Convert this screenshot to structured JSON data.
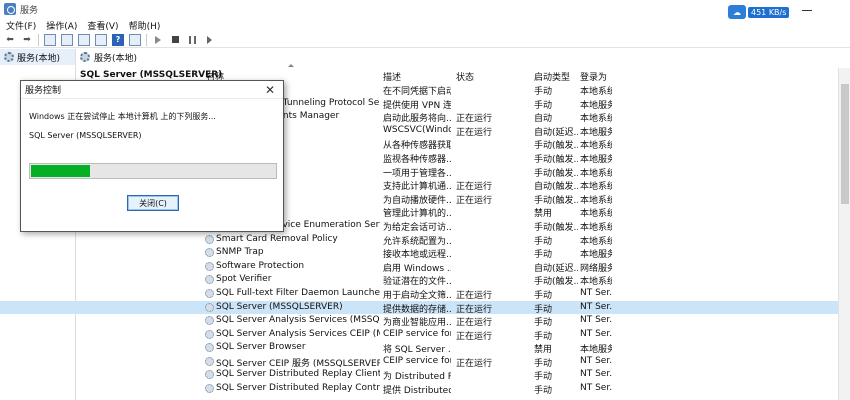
{
  "window": {
    "title": "服务",
    "net_speed": "451 KB/s"
  },
  "menu": [
    "文件(F)",
    "操作(A)",
    "查看(V)",
    "帮助(H)"
  ],
  "tree": {
    "root_label": "服务(本地)"
  },
  "main": {
    "header": "服务(本地)",
    "selected_service_title": "SQL Server (MSSQLSERVER)"
  },
  "table": {
    "headers": {
      "name": "名称",
      "description": "描述",
      "status": "状态",
      "startup": "启动类型",
      "login": "登录为"
    },
    "rows": [
      {
        "name": "",
        "description": "在不同凭据下启动",
        "status": "",
        "startup": "手动",
        "login": "本地系统"
      },
      {
        "name": "Secure Socket Tunneling Protocol Service",
        "description": "提供使用 VPN 连...",
        "status": "",
        "startup": "手动",
        "login": "本地服务"
      },
      {
        "name": "Security Accounts Manager",
        "description": "启动此服务将向...",
        "status": "正在运行",
        "startup": "自动",
        "login": "本地系统"
      },
      {
        "name": "",
        "description": "WSCSVC(Windo...",
        "status": "正在运行",
        "startup": "自动(延迟...",
        "login": "本地服务"
      },
      {
        "name": "",
        "description": "从各种传感器获取...",
        "status": "",
        "startup": "手动(触发...",
        "login": "本地系统"
      },
      {
        "name": "",
        "description": "监视各种传感器...",
        "status": "",
        "startup": "手动(触发...",
        "login": "本地服务"
      },
      {
        "name": "",
        "description": "一项用于管理各...",
        "status": "",
        "startup": "手动(触发...",
        "login": "本地系统"
      },
      {
        "name": "",
        "description": "支持此计算机通...",
        "status": "正在运行",
        "startup": "自动(触发...",
        "login": "本地系统"
      },
      {
        "name": "",
        "description": "为自动播放硬件...",
        "status": "正在运行",
        "startup": "手动(触发...",
        "login": "本地系统"
      },
      {
        "name": "",
        "description": "管理此计算机的...",
        "status": "",
        "startup": "禁用",
        "login": "本地系统"
      },
      {
        "name": "Smart Card Device Enumeration Service",
        "description": "为给定会话可访...",
        "status": "",
        "startup": "手动(触发...",
        "login": "本地系统"
      },
      {
        "name": "Smart Card Removal Policy",
        "description": "允许系统配置为...",
        "status": "",
        "startup": "手动",
        "login": "本地系统"
      },
      {
        "name": "SNMP Trap",
        "description": "接收本地或远程...",
        "status": "",
        "startup": "手动",
        "login": "本地服务"
      },
      {
        "name": "Software Protection",
        "description": "启用 Windows ...",
        "status": "",
        "startup": "自动(延迟...",
        "login": "网络服务"
      },
      {
        "name": "Spot Verifier",
        "description": "验证潜在的文件...",
        "status": "",
        "startup": "手动(触发...",
        "login": "本地系统"
      },
      {
        "name": "SQL Full-text Filter Daemon Launcher (MS...",
        "description": "用于启动全文筛...",
        "status": "正在运行",
        "startup": "手动",
        "login": "NT Ser..."
      },
      {
        "name": "SQL Server (MSSQLSERVER)",
        "description": "提供数据的存储...",
        "status": "正在运行",
        "startup": "手动",
        "login": "NT Ser...",
        "selected": true
      },
      {
        "name": "SQL Server Analysis Services (MSSQLSER...",
        "description": "为商业智能应用...",
        "status": "正在运行",
        "startup": "手动",
        "login": "NT Ser..."
      },
      {
        "name": "SQL Server Analysis Services CEIP (MSSQ...",
        "description": "CEIP service for ...",
        "status": "正在运行",
        "startup": "手动",
        "login": "NT Ser..."
      },
      {
        "name": "SQL Server Browser",
        "description": "将 SQL Server ...",
        "status": "",
        "startup": "禁用",
        "login": "本地服务"
      },
      {
        "name": "SQL Server CEIP 服务 (MSSQLSERVER)",
        "description": "CEIP service for ...",
        "status": "正在运行",
        "startup": "手动",
        "login": "NT Ser..."
      },
      {
        "name": "SQL Server Distributed Replay Client",
        "description": "为 Distributed R...",
        "status": "",
        "startup": "手动",
        "login": "NT Ser..."
      },
      {
        "name": "SQL Server Distributed Replay Controller",
        "description": "提供 Distributed...",
        "status": "",
        "startup": "手动",
        "login": "NT Ser..."
      }
    ]
  },
  "dialog": {
    "title": "服务控制",
    "message": "Windows 正在尝试停止 本地计算机 上的下列服务...",
    "service": "SQL Server (MSSQLSERVER)",
    "progress": 0.24,
    "close_button": "关闭(C)"
  },
  "colors": {
    "progress": "#06b025",
    "selection": "#cce4f7"
  }
}
